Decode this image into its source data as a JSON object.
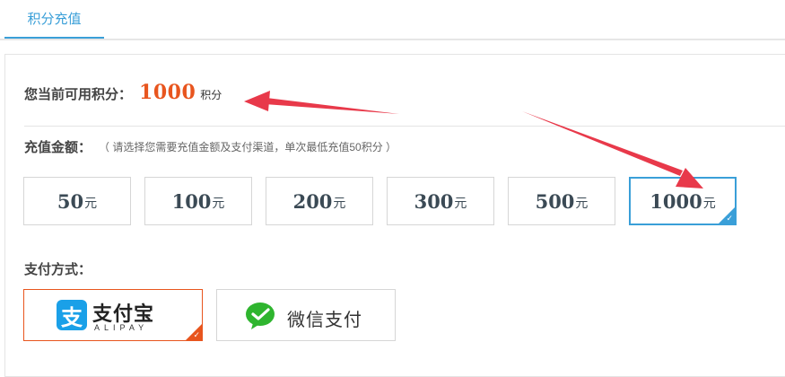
{
  "tabs": [
    {
      "label": "积分充值"
    }
  ],
  "points": {
    "label": "您当前可用积分：",
    "value": "1000",
    "unit": "积分"
  },
  "recharge": {
    "label": "充值金额：",
    "hint": "（ 请选择您需要充值金额及支付渠道，单次最低充值50积分 ）",
    "currency": "元",
    "options": [
      {
        "amount": "50"
      },
      {
        "amount": "100"
      },
      {
        "amount": "200"
      },
      {
        "amount": "300"
      },
      {
        "amount": "500"
      },
      {
        "amount": "1000"
      }
    ],
    "selected_amount": "1000"
  },
  "payment": {
    "label": "支付方式：",
    "alipay": {
      "logo_glyph": "支",
      "title": "支付宝",
      "sub": "ALIPAY"
    },
    "wechat": {
      "title": "微信支付"
    },
    "selected": "alipay"
  },
  "colors": {
    "accent": "#3a9fd8",
    "highlight": "#e8551e",
    "arrow": "#e8394a"
  },
  "icons": {
    "check": "✓"
  }
}
